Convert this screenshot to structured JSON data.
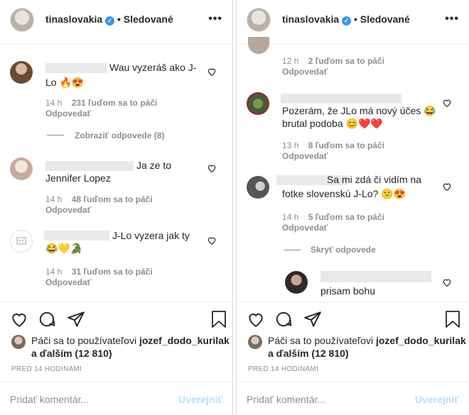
{
  "panels": {
    "left": {
      "header": {
        "username": "tinaslovakia",
        "dot": "•",
        "follow_label": "Sledované",
        "more": "•••"
      },
      "comments": [
        {
          "text_line1": "Wau vyzeráš ako J-",
          "text_line2": "Lo 🔥😍",
          "time": "14 h",
          "likes": "231 ľuďom sa to páči",
          "reply": "Odpovedať"
        },
        {
          "text_line1": "Ja ze to",
          "text_line2": "Jennifer Lopez",
          "time": "14 h",
          "likes": "48 ľuďom sa to páči",
          "reply": "Odpovedať"
        },
        {
          "text_line1": "J-Lo vyzera jak ty",
          "text_line2": "😂💛🐊",
          "time": "14 h",
          "likes": "31 ľuďom sa to páči",
          "reply": "Odpovedať"
        }
      ],
      "view_replies": "Zobraziť odpovede (8)",
      "liked_by_prefix": "Páči sa to používateľovi ",
      "liked_by_user": "jozef_dodo_kurilak",
      "liked_by_suffix": "a ďalším (12 810)",
      "timestamp": "PRED 14 HODINAMI",
      "add_comment_placeholder": "Pridať komentár...",
      "post_label": "Uverejniť"
    },
    "right": {
      "header": {
        "username": "tinaslovakia",
        "dot": "•",
        "follow_label": "Sledované",
        "more": "•••"
      },
      "top_meta": {
        "time": "12 h",
        "likes": "2 ľuďom sa to páči",
        "reply": "Odpovedať"
      },
      "comments": [
        {
          "text_line1": "Pozerám, že JLo má nový účes 😂",
          "text_line2": "brutal podoba 😊❤️❤️",
          "time": "13 h",
          "likes": "8 ľuďom sa to páči",
          "reply": "Odpovedať"
        },
        {
          "text_line1": "Sa mi zdá či vidím na",
          "text_line2": "fotke slovenskú J-Lo? 😕😍",
          "time": "14 h",
          "likes": "5 ľuďom sa to páči",
          "reply": "Odpovedať"
        }
      ],
      "hide_replies": "Skryť odpovede",
      "reply_comment": "prisam bohu",
      "liked_by_prefix": "Páči sa to používateľovi ",
      "liked_by_user": "jozef_dodo_kurilak",
      "liked_by_suffix": "a ďalším (12 810)",
      "timestamp": "PRED 14 HODINAMI",
      "add_comment_placeholder": "Pridať komentár...",
      "post_label": "Uverejniť"
    }
  },
  "colors": {
    "verified": "#3897f0",
    "muted": "#8e8e8e",
    "post_disabled": "#b2dffc",
    "heart_red": "#ed4956"
  },
  "icons": {
    "verified": "verified-badge-icon",
    "like": "heart-icon",
    "comment": "comment-icon",
    "share": "share-icon",
    "save": "bookmark-icon"
  }
}
